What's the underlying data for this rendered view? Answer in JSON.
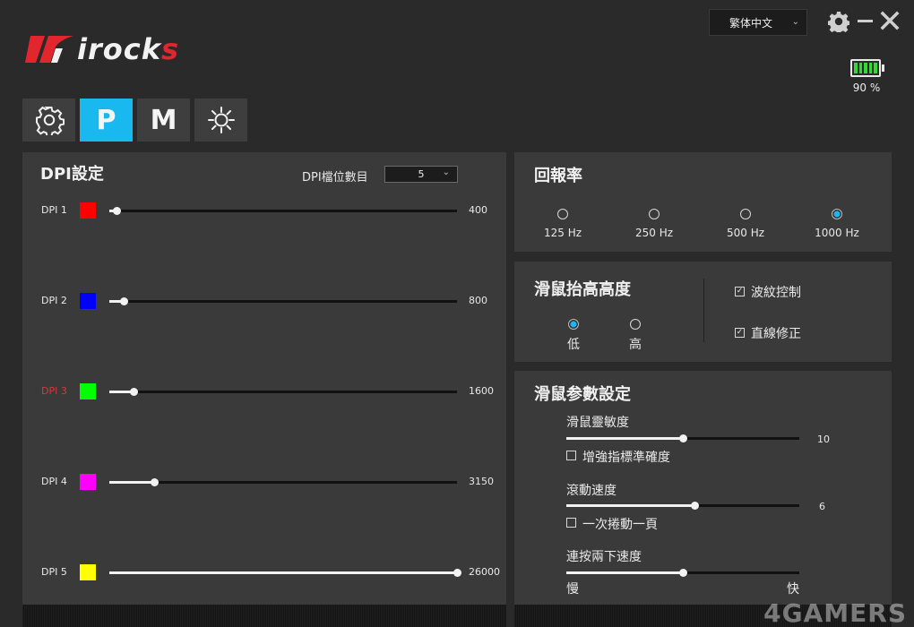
{
  "header": {
    "brand": "irocks",
    "language": "繁体中文",
    "battery_text": "90 %",
    "battery_level": 0.9
  },
  "tabs": [
    {
      "id": "settings",
      "icon": "gear-icon",
      "label": ""
    },
    {
      "id": "profile",
      "label": "P"
    },
    {
      "id": "macro",
      "label": "M"
    },
    {
      "id": "lighting",
      "icon": "sun-icon",
      "label": ""
    }
  ],
  "dpi": {
    "title": "DPI設定",
    "count_label": "DPI檔位數目",
    "count_value": "5",
    "levels": [
      {
        "label": "DPI 1",
        "color": "#ff0000",
        "value": "400",
        "fraction": 0.02
      },
      {
        "label": "DPI 2",
        "color": "#0000ff",
        "value": "800",
        "fraction": 0.04
      },
      {
        "label": "DPI 3",
        "color": "#00ff00",
        "value": "1600",
        "fraction": 0.07
      },
      {
        "label": "DPI 4",
        "color": "#ff00ff",
        "value": "3150",
        "fraction": 0.13
      },
      {
        "label": "DPI 5",
        "color": "#ffff00",
        "value": "26000",
        "fraction": 1.0
      }
    ]
  },
  "report_rate": {
    "title": "回報率",
    "options": [
      {
        "label": "125 Hz",
        "selected": false
      },
      {
        "label": "250 Hz",
        "selected": false
      },
      {
        "label": "500 Hz",
        "selected": false
      },
      {
        "label": "1000 Hz",
        "selected": true
      }
    ]
  },
  "lift_off": {
    "title": "滑鼠抬高高度",
    "options": [
      {
        "label": "低",
        "selected": true
      },
      {
        "label": "高",
        "selected": false
      }
    ],
    "checkboxes": [
      {
        "label": "波紋控制",
        "checked": true
      },
      {
        "label": "直線修正",
        "checked": true
      }
    ]
  },
  "params": {
    "title": "滑鼠参數設定",
    "sensitivity": {
      "label": "滑鼠靈敏度",
      "value": "10",
      "fraction": 0.5,
      "checkbox": "增強指標準確度"
    },
    "scroll": {
      "label": "滾動速度",
      "value": "6",
      "fraction": 0.55,
      "checkbox": "一次捲動一頁"
    },
    "double_click": {
      "label": "連按兩下速度",
      "fraction": 0.5,
      "min_label": "慢",
      "max_label": "快"
    }
  },
  "watermark": "4GAMERS"
}
